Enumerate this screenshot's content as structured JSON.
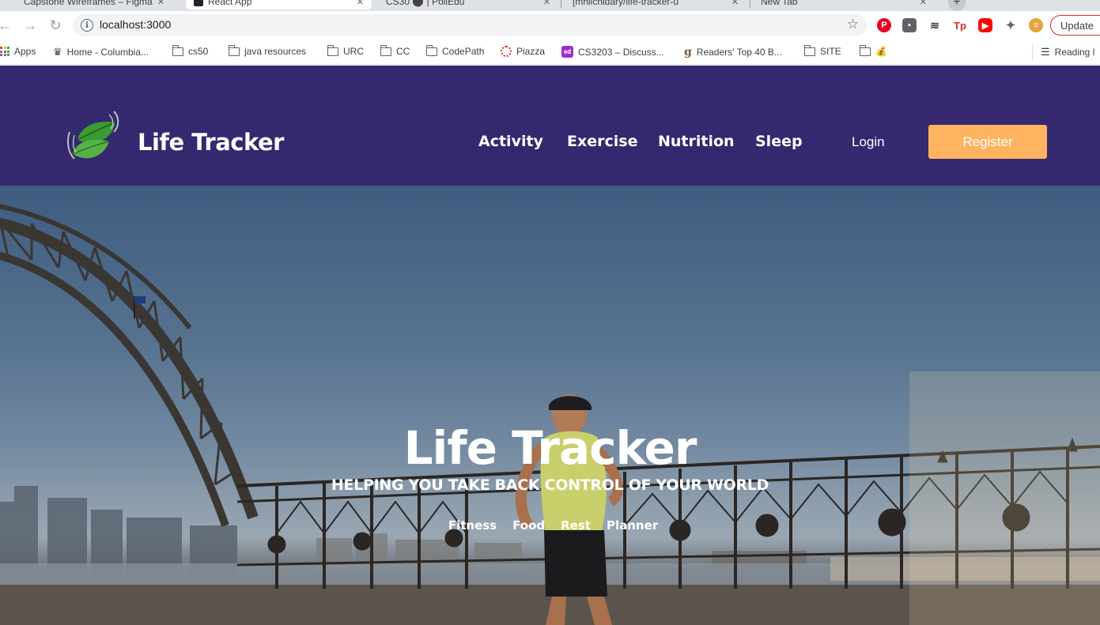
{
  "browser": {
    "tabs": [
      {
        "title": "Capstone Wireframes – Figma"
      },
      {
        "title": "React App"
      },
      {
        "title": "CS30 ⚫ | PollEdu"
      },
      {
        "title": "[mhiichidary/life-tracker-u"
      },
      {
        "title": "New Tab"
      }
    ],
    "url": "localhost:3000",
    "update_label": "Update",
    "bookmarks": [
      {
        "label": "Apps",
        "icon": "apps-grid-icon"
      },
      {
        "label": "Home - Columbia...",
        "icon": "crown-icon"
      },
      {
        "label": "cs50",
        "icon": "folder-icon"
      },
      {
        "label": "java resources",
        "icon": "folder-icon"
      },
      {
        "label": "URC",
        "icon": "folder-icon"
      },
      {
        "label": "CC",
        "icon": "folder-icon"
      },
      {
        "label": "CodePath",
        "icon": "folder-icon"
      },
      {
        "label": "Piazza",
        "icon": "piazza-icon"
      },
      {
        "label": "CS3203 – Discuss...",
        "icon": "ed-icon"
      },
      {
        "label": "Readers' Top 40 B...",
        "icon": "goodreads-icon"
      },
      {
        "label": "SITE",
        "icon": "folder-icon"
      },
      {
        "label": "💰",
        "icon": "folder-icon"
      }
    ],
    "reading_list": "Reading l",
    "extensions": [
      "pinterest-icon",
      "pocket-icon",
      "readermode-icon",
      "tp-icon",
      "youtube-icon",
      "puzzle-icon",
      "burger-icon"
    ]
  },
  "navbar": {
    "brand": "Life Tracker",
    "links": [
      {
        "label": "Activity"
      },
      {
        "label": "Exercise"
      },
      {
        "label": "Nutrition"
      },
      {
        "label": "Sleep"
      }
    ],
    "login_label": "Login",
    "register_label": "Register",
    "colors": {
      "background": "#35286e",
      "accent": "#fdb35f"
    }
  },
  "hero": {
    "title": "Life Tracker",
    "subtitle": "HELPING YOU TAKE BACK CONTROL OF YOUR WORLD",
    "links": [
      {
        "label": "Fitness"
      },
      {
        "label": "Food"
      },
      {
        "label": "Rest"
      },
      {
        "label": "Planner"
      }
    ]
  }
}
